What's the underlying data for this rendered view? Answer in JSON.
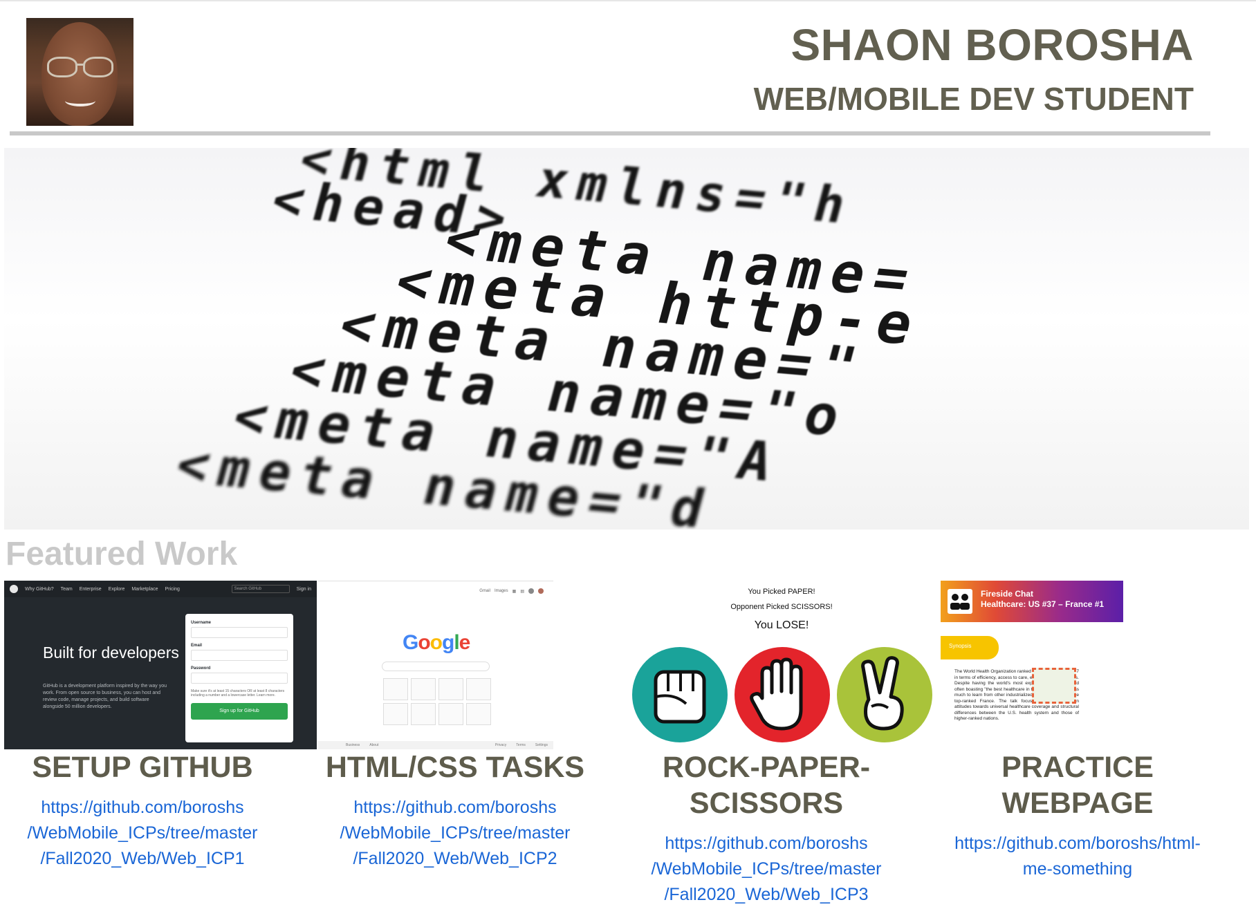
{
  "header": {
    "name": "SHAON BOROSHA",
    "role": "WEB/MOBILE DEV STUDENT"
  },
  "hero_code_lines": [
    "<html xmlns=\"h",
    "<head>",
    "<meta name=",
    "<meta http-e",
    "<meta name=\"",
    "<meta name=\"o",
    "<meta name=\"A",
    "<meta name=\"d"
  ],
  "featured": {
    "heading": "Featured Work"
  },
  "projects": [
    {
      "title_lines": [
        "SETUP GITHUB"
      ],
      "link_lines": [
        "https://github.com/boroshs",
        "/WebMobile_ICPs/tree/master",
        "/Fall2020_Web/Web_ICP1"
      ],
      "thumb": {
        "nav": [
          "Why GitHub?",
          "Team",
          "Enterprise",
          "Explore",
          "Marketplace",
          "Pricing"
        ],
        "search_placeholder": "Search GitHub",
        "sign_in": "Sign in",
        "headline": "Built for developers",
        "description": "GitHub is a development platform inspired by the way you work. From open source to business, you can host and review code, manage projects, and build software alongside 50 million developers.",
        "fields": [
          "Username",
          "Email",
          "Password"
        ],
        "password_hint": "Make sure it's at least 15 characters OR at least 8 characters including a number and a lowercase letter. Learn more.",
        "button": "Sign up for GitHub"
      }
    },
    {
      "title_lines": [
        "HTML/CSS TASKS"
      ],
      "link_lines": [
        "https://github.com/boroshs",
        "/WebMobile_ICPs/tree/master",
        "/Fall2020_Web/Web_ICP2"
      ],
      "thumb": {
        "top_links": [
          "Gmail",
          "Images"
        ],
        "logo": "Google",
        "footer": [
          "Business",
          "About",
          "Privacy",
          "Terms",
          "Settings"
        ]
      }
    },
    {
      "title_lines": [
        "ROCK-PAPER-",
        "SCISSORS"
      ],
      "link_lines": [
        "https://github.com/boroshs",
        "/WebMobile_ICPs/tree/master",
        "/Fall2020_Web/Web_ICP3"
      ],
      "thumb": {
        "you_picked": "You Picked PAPER!",
        "opponent_picked": "Opponent Picked SCISSORS!",
        "result": "You LOSE!"
      }
    },
    {
      "title_lines": [
        "PRACTICE",
        "WEBPAGE"
      ],
      "link_lines": [
        "https://github.com/boroshs/html-",
        "me-something"
      ],
      "thumb": {
        "banner_line1": "Fireside Chat",
        "banner_line2": "Healthcare: US #37 – France #1",
        "synopsis": "Synopsis",
        "body": "The World Health Organization ranked U.S. health system #37 in terms of efficiency, access to care, equity, and healthy lives. Despite having the world's most expensive healthcare and often boasting \"the best healthcare in the world\", the U.S. has much to learn from other industrialized nations, especially the top-ranked France. The talk focused on differences in attitudes towards universal healthcare coverage and structural differences between the U.S. health system and those of higher-ranked nations."
      }
    }
  ],
  "colors": {
    "heading_text": "#626050",
    "link": "#1a66d6",
    "featured_heading": "#c9c9c9",
    "rule": "#c8c8c8"
  }
}
